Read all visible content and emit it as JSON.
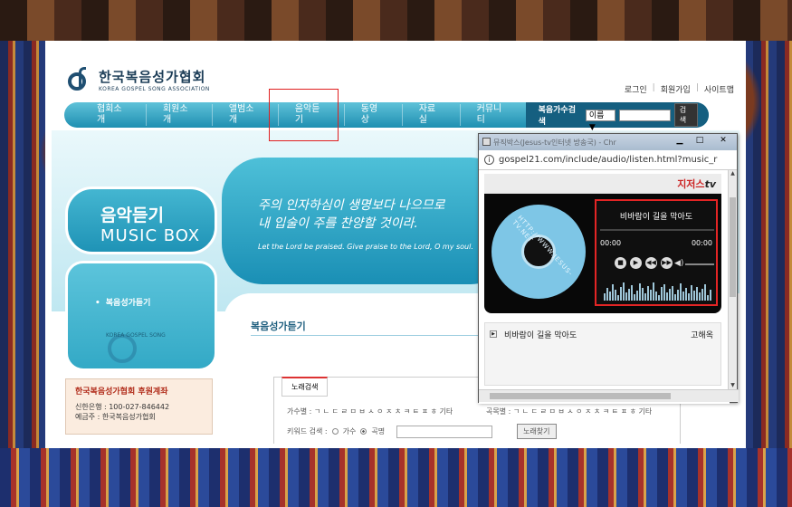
{
  "site": {
    "logo_ko": "한국복음성가협회",
    "logo_en": "KOREA GOSPEL SONG ASSOCIATION",
    "top_links": [
      "로그인",
      "회원가입",
      "사이트맵"
    ],
    "nav": [
      "협회소개",
      "회원소개",
      "앨범소개",
      "음악듣기",
      "동영상",
      "자료실",
      "커뮤니티"
    ],
    "search_label": "복음가수검색",
    "search_select": "이름 ▼",
    "search_button": "검색",
    "music_ko": "음악듣기",
    "music_en": "MUSIC BOX",
    "verse_l1": "주의 인자하심이 생명보다 나으므로",
    "verse_l2": "내 입술이 주를 찬양할 것이라.",
    "verse_en": "Let the Lord be praised. Give praise to the Lord, O my soul.",
    "side_item": "복음성가듣기",
    "side_emblem": "KOREA GOSPEL SONG",
    "donation_title": "한국복음성가협회 후원계좌",
    "donation_bank": "신한은행 : 100-027-846442",
    "donation_holder": "예금주 : 한국복음성가협회",
    "content_title": "복음성가듣기",
    "tab_label": "노래검색",
    "singer_row": "가수별 :  ㄱ ㄴ ㄷ ㄹ ㅁ ㅂ ㅅ ㅇ ㅈ ㅊ ㅋ ㅌ ㅍ ㅎ 기타",
    "song_row": "곡목별 :  ㄱ ㄴ ㄷ ㄹ ㅁ ㅂ ㅅ ㅇ ㅈ ㅊ ㅋ ㅌ ㅍ ㅎ 기타",
    "keyword_label": "키워드 검색 :",
    "radio_singer": "가수",
    "radio_song": "곡명",
    "search_song_button": "노래찾기"
  },
  "popup": {
    "title": "뮤직박스(Jesus-tv인터넷 방송국) - Chr",
    "url": "gospel21.com/include/audio/listen.html?music_r",
    "brand": "지저스",
    "brand_tv": "tv",
    "cd_text": "HTTP://WWW.JESUS-TV.NET",
    "song_title": "비바람이 길을 막아도",
    "time_start": "00:00",
    "time_end": "00:00",
    "playlist_song": "비바람이 길을 막아도",
    "playlist_artist": "고해옥"
  }
}
